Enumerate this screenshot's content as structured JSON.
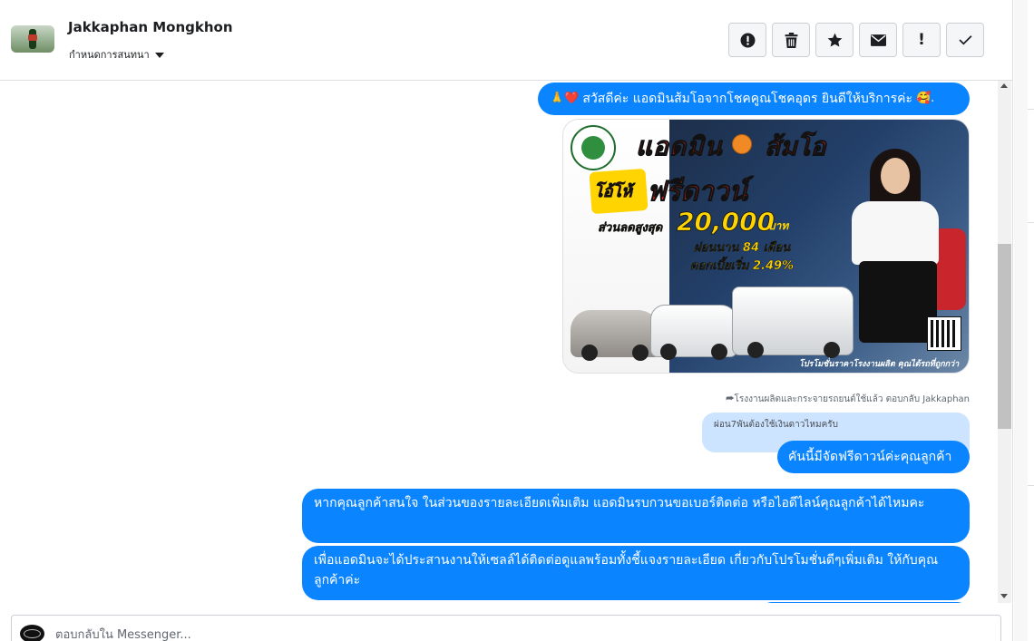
{
  "header": {
    "contact_name": "Jakkaphan Mongkhon",
    "assign_label": "กำหนดการสนทนา"
  },
  "toolbar": {
    "icons": [
      "alert-circle-icon",
      "trash-icon",
      "star-icon",
      "mail-icon",
      "exclamation-icon",
      "check-icon"
    ],
    "exclamation_glyph": "!"
  },
  "messages": {
    "greeting_emoji_prefix": "🙏❤️",
    "greeting_text": "สวัสดีค่ะ แอดมินส้มโอจากโชคคูณโชคอุดร ยินดีให้บริการค่ะ",
    "greeting_emoji_suffix": "🥰.",
    "promo": {
      "headline_left": "แอดมิน",
      "headline_right": "ส้มโอ",
      "giveaway": "โอ้โห้",
      "free_down": "ฟรีดาวน์",
      "discount_label": "ส่วนลดสูงสุด",
      "discount_value": "20,000",
      "discount_unit": "บาท",
      "installment": "ผ่อนนาน 84 เดือน",
      "interest": "ดอกเบี้ยเริ่ม 2.49%",
      "footer": "โปรโมชั่นราคาโรงงานผลิต คุณได้รถที่ถูกกว่า"
    },
    "reply_meta_prefix": "โรงงานผลิตและกระจายรถยนต์ใช้แล้ว ตอบกลับ",
    "reply_meta_name": "Jakkaphan",
    "quoted_text": "ผ่อน7พันต้องใช้เงินดาวไหมครับ",
    "reply_text": "คันนี้มีจัดฟรีดาวน์ค่ะคุณลูกค้า",
    "msg3": "หากคุณลูกค้าสนใจ ในส่วนของรายละเอียดเพิ่มเติม แอดมินรบกวนขอเบอร์ติดต่อ หรือไอดีไลน์คุณลูกค้าได้ไหมคะ",
    "msg4": "เพื่อแอดมินจะได้ประสานงานให้เซลล์ได้ติดต่อดูแลพร้อมทั้งชี้แจงรายละเอียด เกี่ยวกับโปรโมชั่นดีๆเพิ่มเติม ให้กับคุณลูกค้าค่ะ"
  },
  "composer": {
    "placeholder": "ตอบกลับใน Messenger..."
  },
  "colors": {
    "accent": "#0a84ff",
    "quoted_bg": "#cce4ff"
  }
}
